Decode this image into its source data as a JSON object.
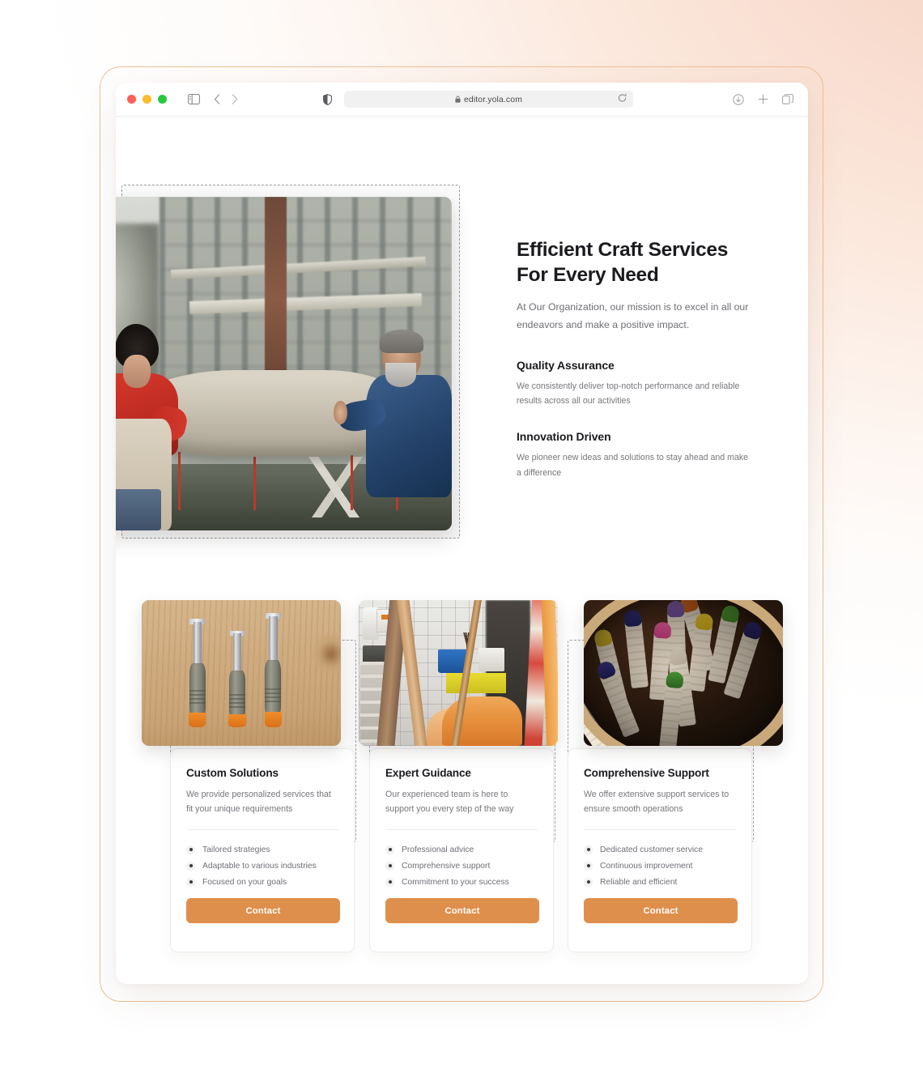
{
  "browser": {
    "url": "editor.yola.com",
    "lock_icon": "lock-icon",
    "traffic_lights": [
      "close-red",
      "minimize-yellow",
      "maximize-green"
    ],
    "icons": {
      "sidebar": "sidebar-toggle-icon",
      "back": "chevron-left-icon",
      "forward": "chevron-right-icon",
      "shield": "privacy-shield-icon",
      "reload": "reload-icon",
      "download": "download-icon",
      "new_tab": "plus-icon",
      "tab_overview": "tab-overview-icon"
    }
  },
  "hero": {
    "image_alt": "two craftsmen restoring a stone statue in a workshop yard",
    "title": "Efficient Craft Services For Every Need",
    "subtitle": "At Our Organization, our mission is to excel in all our endeavors and make a positive impact.",
    "features": [
      {
        "heading": "Quality Assurance",
        "text": "We consistently deliver top-notch performance and reliable results across all our activities"
      },
      {
        "heading": "Innovation Driven",
        "text": "We pioneer new ideas and solutions to stay ahead and make a difference"
      }
    ]
  },
  "cards": [
    {
      "image_alt": "three wood chisels with orange handles on a wooden board",
      "title": "Custom Solutions",
      "blurb": "We provide personalized services that fit your unique requirements",
      "bullets": [
        "Tailored strategies",
        "Adaptable to various industries",
        "Focused on your goals"
      ],
      "button": "Contact"
    },
    {
      "image_alt": "cluttered art studio with brushes, blue bucket and orange fabric",
      "title": "Expert Guidance",
      "blurb": "Our experienced team is here to support you every step of the way",
      "bullets": [
        "Professional advice",
        "Comprehensive support",
        "Commitment to your success"
      ],
      "button": "Contact"
    },
    {
      "image_alt": "colorful crayons in a wooden bowl",
      "title": "Comprehensive Support",
      "blurb": "We offer extensive support services to ensure smooth operations",
      "bullets": [
        "Dedicated customer service",
        "Continuous improvement",
        "Reliable and efficient"
      ],
      "button": "Contact"
    }
  ],
  "colors": {
    "accent_orange": "#df8f4c",
    "frame_tan": "#edc094",
    "backdrop_peach": "#f8dbcd",
    "heading": "#1b1b1f",
    "body_text": "#77777d",
    "selection_dash": "#a4a4a4"
  }
}
